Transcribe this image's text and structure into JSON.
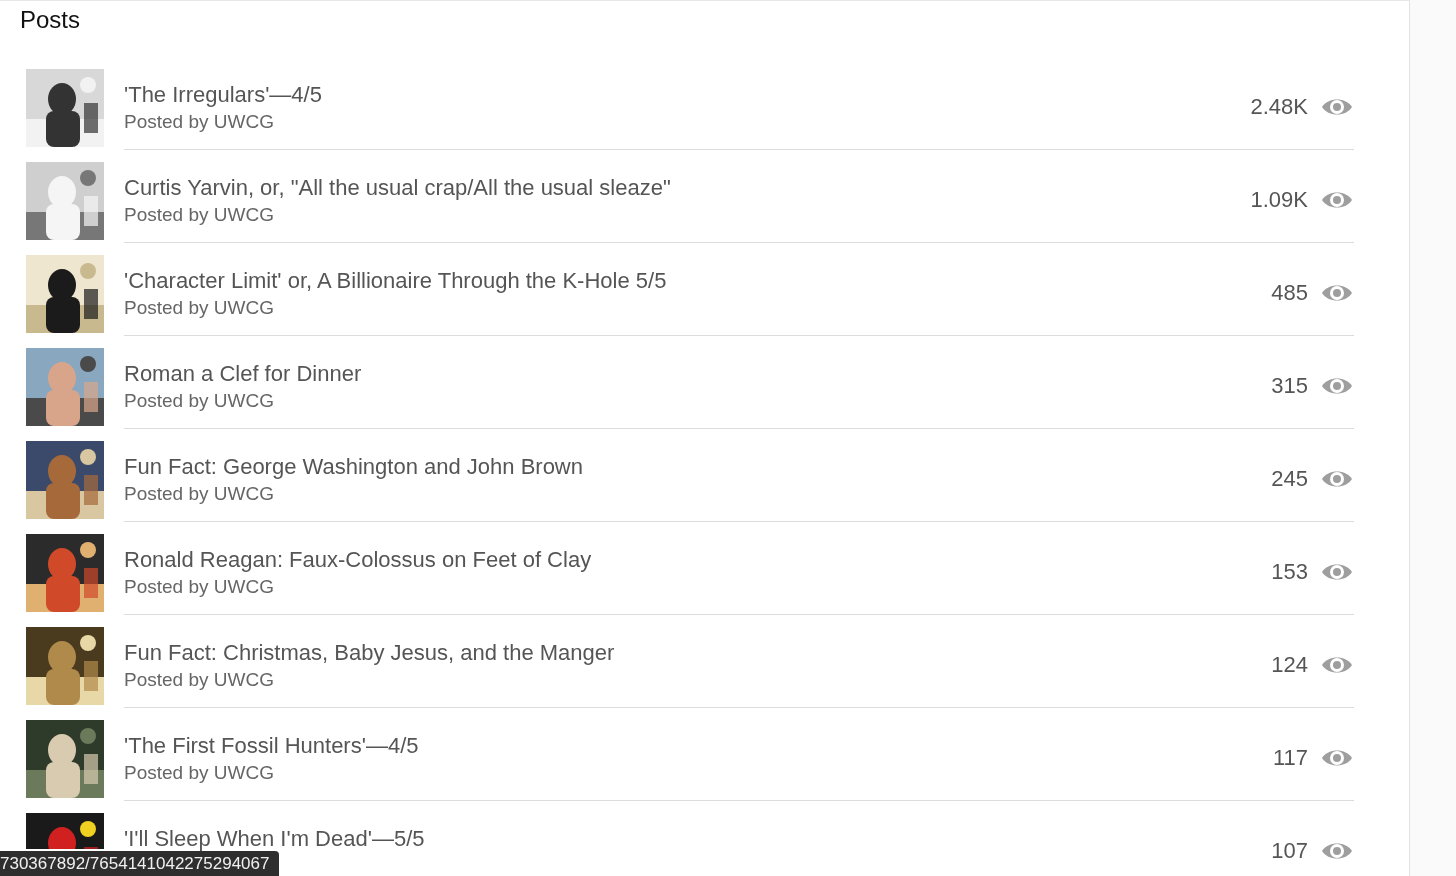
{
  "header": {
    "title": "Posts"
  },
  "posts": [
    {
      "title": "'The Irregulars'—4/5",
      "byline": "Posted by UWCG",
      "views": "2.48K"
    },
    {
      "title": "Curtis Yarvin, or, \"All the usual crap/All the usual sleaze\"",
      "byline": "Posted by UWCG",
      "views": "1.09K"
    },
    {
      "title": "'Character Limit' or, A Billionaire Through the K-Hole 5/5",
      "byline": "Posted by UWCG",
      "views": "485"
    },
    {
      "title": "Roman a Clef for Dinner",
      "byline": "Posted by UWCG",
      "views": "315"
    },
    {
      "title": "Fun Fact: George Washington and John Brown",
      "byline": "Posted by UWCG",
      "views": "245"
    },
    {
      "title": "Ronald Reagan: Faux-Colossus on Feet of Clay",
      "byline": "Posted by UWCG",
      "views": "153"
    },
    {
      "title": "Fun Fact: Christmas, Baby Jesus, and the Manger",
      "byline": "Posted by UWCG",
      "views": "124"
    },
    {
      "title": "'The First Fossil Hunters'—4/5",
      "byline": "Posted by UWCG",
      "views": "117"
    },
    {
      "title": "'I'll Sleep When I'm Dead'—5/5",
      "views": "107"
    }
  ],
  "status_bar": {
    "url": "730367892/7654141042275294067"
  }
}
